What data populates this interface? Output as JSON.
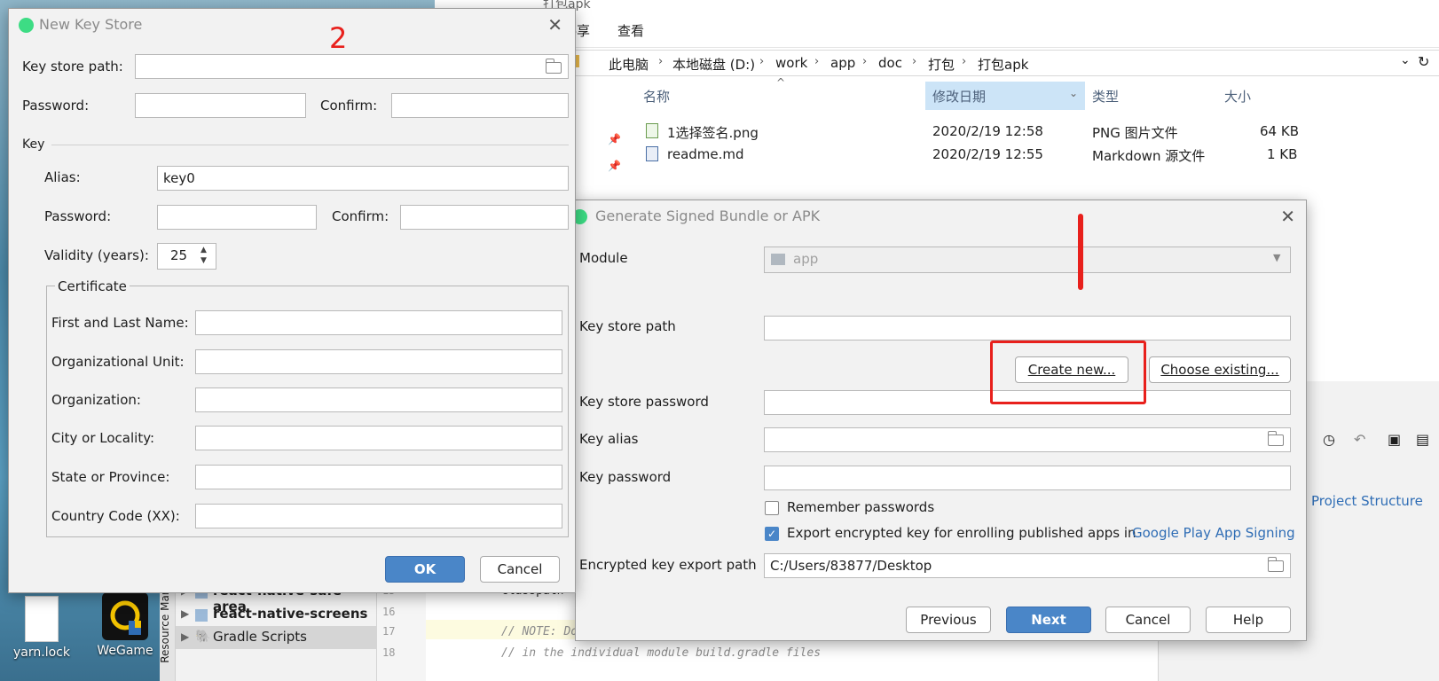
{
  "annotations": {
    "number": "2"
  },
  "explorer": {
    "title": "打包apk",
    "ribbon": [
      "共享",
      "查看"
    ],
    "breadcrumb": [
      "此电脑",
      "本地磁盘 (D:)",
      "work",
      "app",
      "doc",
      "打包",
      "打包apk"
    ],
    "columns": {
      "name": "名称",
      "date": "修改日期",
      "type": "类型",
      "size": "大小"
    },
    "files": [
      {
        "name": "1选择签名.png",
        "date": "2020/2/19 12:58",
        "type": "PNG 图片文件",
        "size": "64 KB"
      },
      {
        "name": "readme.md",
        "date": "2020/2/19 12:55",
        "type": "Markdown 源文件",
        "size": "1 KB"
      }
    ]
  },
  "desktop": {
    "icons": [
      "yarn.lock",
      "WeGame"
    ]
  },
  "ide": {
    "tool_window": "Resource Mana",
    "tree": [
      "react-native-safe-area",
      "react-native-screens",
      "Gradle Scripts"
    ],
    "lines": [
      {
        "num": "15",
        "code": "classpath"
      },
      {
        "num": "16",
        "code": ""
      },
      {
        "num": "17",
        "code": "// NOTE: Do not place your application dependencies here; they belong"
      },
      {
        "num": "18",
        "code": "// in the individual module build.gradle files"
      }
    ],
    "project_structure": "Project Structure"
  },
  "keystore_dialog": {
    "title": "New Key Store",
    "key_store_path_label": "Key store path:",
    "password_label": "Password:",
    "confirm_label": "Confirm:",
    "key_section": "Key",
    "alias_label": "Alias:",
    "alias_value": "key0",
    "key_password_label": "Password:",
    "key_confirm_label": "Confirm:",
    "validity_label": "Validity (years):",
    "validity_value": "25",
    "certificate_section": "Certificate",
    "cert_fields": [
      "First and Last Name:",
      "Organizational Unit:",
      "Organization:",
      "City or Locality:",
      "State or Province:",
      "Country Code (XX):"
    ],
    "ok": "OK",
    "cancel": "Cancel"
  },
  "apk_dialog": {
    "title": "Generate Signed Bundle or APK",
    "module_label": "Module",
    "module_value": "app",
    "key_store_path_label": "Key store path",
    "create_new": "Create new...",
    "choose_existing": "Choose existing...",
    "key_store_password_label": "Key store password",
    "key_alias_label": "Key alias",
    "key_password_label": "Key password",
    "remember_passwords": "Remember passwords",
    "export_encrypted": "Export encrypted key for enrolling published apps in",
    "google_play_link": "Google Play App Signing",
    "export_path_label": "Encrypted key export path",
    "export_path_value": "C:/Users/83877/Desktop",
    "previous": "Previous",
    "next": "Next",
    "cancel": "Cancel",
    "help": "Help"
  },
  "colors": {
    "annotation_red": "#e8201c",
    "link_blue": "#2f6db5",
    "primary_blue": "#4a86c8"
  }
}
